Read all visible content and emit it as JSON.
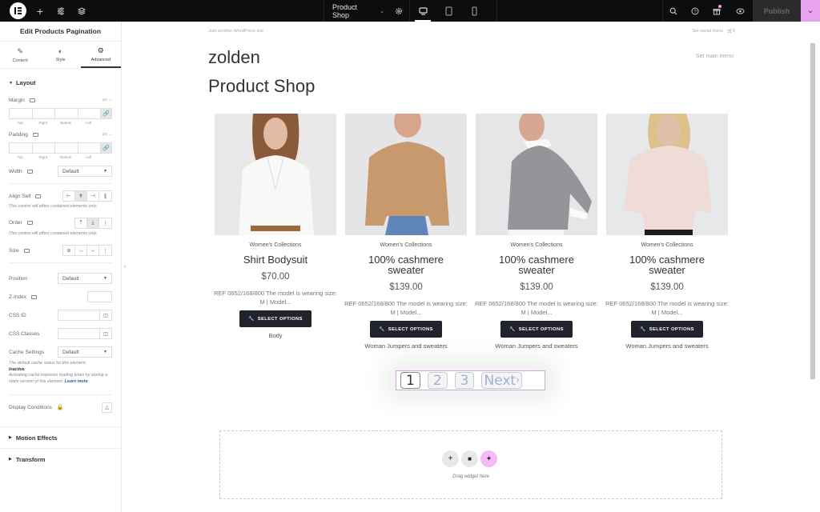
{
  "topbar": {
    "document_title": "Product Shop",
    "publish_label": "Publish",
    "accent_color": "#e8a3f0"
  },
  "panel": {
    "title": "Edit Products Pagination",
    "tabs": [
      {
        "label": "Content",
        "icon": "pencil-icon"
      },
      {
        "label": "Style",
        "icon": "contrast-icon"
      },
      {
        "label": "Advanced",
        "icon": "gear-icon",
        "active": true
      }
    ],
    "layout": {
      "title": "Layout",
      "margin_label": "Margin",
      "padding_label": "Padding",
      "unit": "px",
      "quad_labels": [
        "Top",
        "Right",
        "Bottom",
        "Left"
      ],
      "width_label": "Width",
      "width_value": "Default",
      "align_self_label": "Align Self",
      "note_contained": "This control will affect contained elements only.",
      "order_label": "Order",
      "size_label": "Size",
      "position_label": "Position",
      "position_value": "Default",
      "zindex_label": "Z-Index",
      "css_id_label": "CSS ID",
      "css_classes_label": "CSS Classes",
      "cache_label": "Cache Settings",
      "cache_value": "Default",
      "cache_note_1": "The default cache status for this element:",
      "cache_note_status": "Inactive",
      "cache_note_2": "Activating cache improves loading times by storing a static version of this element.",
      "learn_more": "Learn more",
      "display_conditions_label": "Display Conditions"
    },
    "accordions": [
      "Motion Effects",
      "Transform"
    ]
  },
  "site": {
    "tagline": "Just another WordPress site",
    "social_menu": "Set social menu",
    "cart_count": "0",
    "title": "zolden",
    "main_menu": "Set main menu",
    "page_title": "Product Shop"
  },
  "products": [
    {
      "category": "Women's Collections",
      "name": "Shirt Bodysuit",
      "price": "$70.00",
      "desc": "REF 0652/168/800 The model is wearing size: M | Model...",
      "button": "SELECT OPTIONS",
      "tag": "Body"
    },
    {
      "category": "Women's Collections",
      "name": "100% cashmere sweater",
      "price": "$139.00",
      "desc": "REF 0652/168/800 The model is wearing size: M | Model...",
      "button": "SELECT OPTIONS",
      "tag": "Woman Jumpers and sweaters"
    },
    {
      "category": "Women's Collections",
      "name": "100% cashmere sweater",
      "price": "$139.00",
      "desc": "REF 0652/168/800 The model is wearing size: M | Model...",
      "button": "SELECT OPTIONS",
      "tag": "Woman Jumpers and sweaters"
    },
    {
      "category": "Women's Collections",
      "name": "100% cashmere sweater",
      "price": "$139.00",
      "desc": "REF 0652/168/800 The model is wearing size: M | Model...",
      "button": "SELECT OPTIONS",
      "tag": "Woman Jumpers and sweaters"
    }
  ],
  "pagination": {
    "pages": [
      "1",
      "2",
      "3"
    ],
    "current": "1",
    "next_label": "Next"
  },
  "dropzone": {
    "text": "Drag widget here"
  }
}
